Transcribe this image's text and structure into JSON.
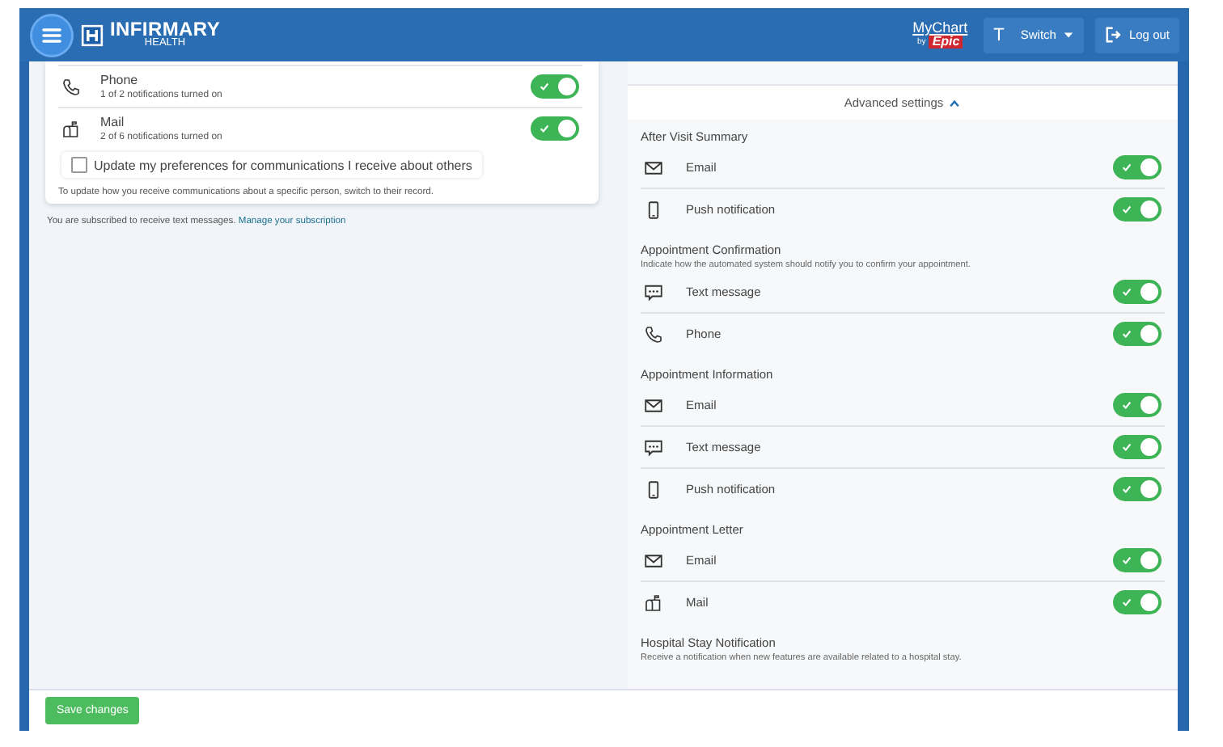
{
  "header": {
    "logo": {
      "name": "INFIRMARY",
      "sub": "HEALTH"
    },
    "mychart": {
      "name": "MyChart",
      "by": "by",
      "brand": "Epic"
    },
    "user": {
      "initial": "T",
      "label": "Switch"
    },
    "logout": "Log out"
  },
  "channels": [
    {
      "kind": "phone",
      "name": "Phone",
      "summary": "1 of 2 notifications turned on",
      "on": true
    },
    {
      "kind": "mail",
      "name": "Mail",
      "summary": "2 of 6 notifications turned on",
      "on": true
    }
  ],
  "others_checkbox": {
    "label": "Update my preferences for communications I receive about others",
    "checked": false
  },
  "others_note": "To update how you receive communications about a specific person, switch to their record.",
  "subscription": {
    "text": "You are subscribed to receive text messages.",
    "link": "Manage your subscription"
  },
  "advanced": {
    "label": "Advanced settings",
    "expanded": true
  },
  "sections": [
    {
      "title": "After Visit Summary",
      "items": [
        {
          "kind": "email",
          "label": "Email",
          "on": true
        },
        {
          "kind": "push",
          "label": "Push notification",
          "on": true
        }
      ]
    },
    {
      "title": "Appointment Confirmation",
      "description": "Indicate how the automated system should notify you to confirm your appointment.",
      "items": [
        {
          "kind": "text",
          "label": "Text message",
          "on": true
        },
        {
          "kind": "phone",
          "label": "Phone",
          "on": true
        }
      ]
    },
    {
      "title": "Appointment Information",
      "items": [
        {
          "kind": "email",
          "label": "Email",
          "on": true
        },
        {
          "kind": "text",
          "label": "Text message",
          "on": true
        },
        {
          "kind": "push",
          "label": "Push notification",
          "on": true
        }
      ]
    },
    {
      "title": "Appointment Letter",
      "items": [
        {
          "kind": "email",
          "label": "Email",
          "on": true
        },
        {
          "kind": "mail",
          "label": "Mail",
          "on": true
        }
      ]
    },
    {
      "title": "Hospital Stay Notification",
      "description": "Receive a notification when new features are available related to a hospital stay."
    }
  ],
  "save_button": "Save changes"
}
